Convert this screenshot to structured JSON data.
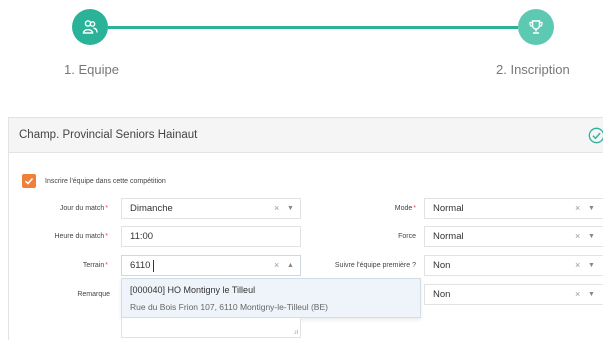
{
  "stepper": {
    "steps": [
      {
        "label": "1. Equipe",
        "icon": "team-icon"
      },
      {
        "label": "2. Inscription",
        "icon": "trophy-icon"
      }
    ]
  },
  "card": {
    "title": "Champ. Provincial Seniors Hainaut",
    "status_icon": "check-circle-icon",
    "enroll_label": "Inscrire l'équipe dans cette compétition",
    "accent": "#2bb39a",
    "checkbox_color": "#f07f3c",
    "required_mark": "*"
  },
  "form": {
    "jour": {
      "label": "Jour du match",
      "value": "Dimanche"
    },
    "heure": {
      "label": "Heure du match",
      "value": "11:00"
    },
    "terrain": {
      "label": "Terrain",
      "value": "6110"
    },
    "remarque": {
      "label": "Remarque"
    },
    "mode": {
      "label": "Mode",
      "value": "Normal"
    },
    "force": {
      "label": "Force",
      "value": "Normal"
    },
    "suivre": {
      "label": "Suivre l'équipe première ?",
      "value": "Non"
    },
    "extra": {
      "value": "Non"
    }
  },
  "dropdown": {
    "option_title": "[000040] HO Montigny le Tilleul",
    "option_address": "Rue du Bois Frion 107, 6110 Montigny-le-Tilleul (BE)"
  },
  "glyphs": {
    "clear": "×",
    "down": "▼",
    "up": "▲"
  }
}
